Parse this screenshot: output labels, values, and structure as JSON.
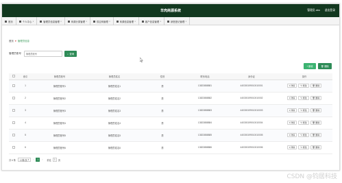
{
  "header": {
    "title": "羊肉商源系统",
    "user": "管理员 abo",
    "logout": "退出登录"
  },
  "nav": [
    {
      "label": "首页",
      "dropdown": false
    },
    {
      "label": "个人中心",
      "dropdown": true
    },
    {
      "label": "管理员信息管理",
      "dropdown": true
    },
    {
      "label": "商源分类管理",
      "dropdown": true
    },
    {
      "label": "供应商管理",
      "dropdown": true
    },
    {
      "label": "商源信息管理",
      "dropdown": true
    },
    {
      "label": "客户信息管理",
      "dropdown": true
    },
    {
      "label": "销售登记管理",
      "dropdown": true
    }
  ],
  "breadcrumb": {
    "home": "首页",
    "current": "管理员信息"
  },
  "search": {
    "label": "管理员账号",
    "placeholder": "管理员账号",
    "button": "查询"
  },
  "actions": {
    "add": "+ 新增",
    "delete": "删除"
  },
  "table": {
    "headers": [
      "",
      "索引",
      "管理员账号",
      "管理员姓名",
      "性别",
      "联系电话",
      "身份证",
      "操作"
    ],
    "rows": [
      {
        "index": "1",
        "account": "管理员账号1",
        "name": "管理员姓名1",
        "gender": "男",
        "phone": "13823888881",
        "idcard": "440300199010010001"
      },
      {
        "index": "2",
        "account": "管理员账号2",
        "name": "管理员姓名2",
        "gender": "男",
        "phone": "13823888882",
        "idcard": "440300199010010002"
      },
      {
        "index": "3",
        "account": "管理员账号3",
        "name": "管理员姓名3",
        "gender": "男",
        "phone": "13823888883",
        "idcard": "440300199010010003"
      },
      {
        "index": "4",
        "account": "管理员账号4",
        "name": "管理员姓名4",
        "gender": "男",
        "phone": "13823888884",
        "idcard": "440300199010010004"
      },
      {
        "index": "5",
        "account": "管理员账号5",
        "name": "管理员姓名5",
        "gender": "男",
        "phone": "13823888885",
        "idcard": "440300199010010005"
      },
      {
        "index": "6",
        "account": "管理员账号6",
        "name": "管理员姓名6",
        "gender": "男",
        "phone": "13823888886",
        "idcard": "440300199010010006"
      }
    ],
    "row_actions": {
      "detail": "详情",
      "edit": "修改",
      "delete": "删除"
    }
  },
  "pagination": {
    "total": "共 6 条",
    "page_size": "10条/页",
    "current_page": "1",
    "goto_label": "前往",
    "goto_value": "1",
    "goto_unit": "页"
  },
  "watermark": "CSDN @钧居科技"
}
